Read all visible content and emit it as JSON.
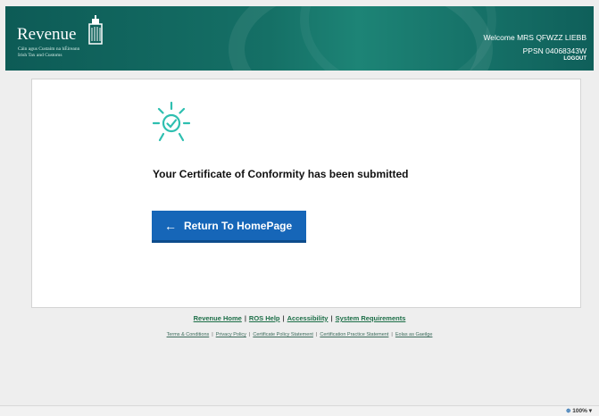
{
  "header": {
    "logo_title": "Revenue",
    "logo_subtitle_irish": "Cáin agus Custaim na hÉireann",
    "logo_subtitle_english": "Irish Tax and Customs",
    "welcome": "Welcome MRS QFWZZ LIEBB",
    "ppsn": "PPSN 04068343W",
    "logout_label": "LOGOUT"
  },
  "main": {
    "message": "Your Certificate of Conformity has been submitted",
    "return_button_label": "Return To HomePage",
    "accent_color": "#2ebfb0",
    "button_color": "#1666b8"
  },
  "footer": {
    "primary_links": [
      "Revenue Home",
      "ROS Help",
      "Accessibility",
      "System Requirements"
    ],
    "secondary_links": [
      "Terms & Conditions",
      "Privacy Policy",
      "Certificate Policy Statement",
      "Certification Practice Statement",
      "Eolas as Gaeilge"
    ],
    "separator": "|"
  },
  "statusbar": {
    "zoom": "100%"
  }
}
